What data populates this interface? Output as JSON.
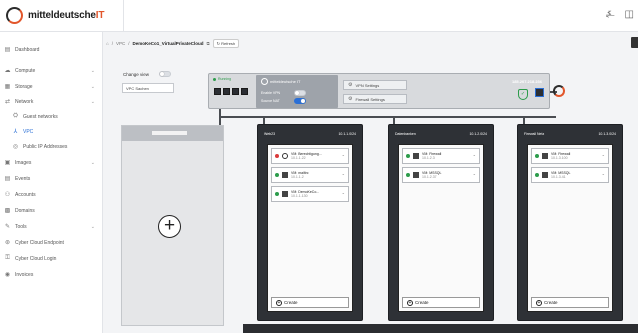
{
  "brand": {
    "name": "mitteldeutsche",
    "suffix": "IT"
  },
  "topbar_icons": [
    "bell-icon",
    "grid-icon"
  ],
  "sidebar": {
    "items": [
      {
        "label": "Dashboard",
        "icon": "dashboard-icon",
        "chevron": false
      },
      {
        "label": "Compute",
        "icon": "cloud-icon",
        "chevron": true
      },
      {
        "label": "Storage",
        "icon": "storage-icon",
        "chevron": true
      },
      {
        "label": "Network",
        "icon": "network-icon",
        "chevron": true
      },
      {
        "label": "Guest networks",
        "icon": "guest-network-icon",
        "chevron": false,
        "sub": true
      },
      {
        "label": "VPC",
        "icon": "vpc-icon",
        "chevron": false,
        "sub": true,
        "active": true
      },
      {
        "label": "Public IP Addresses",
        "icon": "ip-icon",
        "chevron": false,
        "sub": true
      },
      {
        "label": "Images",
        "icon": "image-icon",
        "chevron": true
      },
      {
        "label": "Events",
        "icon": "events-icon",
        "chevron": false
      },
      {
        "label": "Accounts",
        "icon": "accounts-icon",
        "chevron": false
      },
      {
        "label": "Domains",
        "icon": "domains-icon",
        "chevron": false
      },
      {
        "label": "Tools",
        "icon": "tools-icon",
        "chevron": true
      },
      {
        "label": "Cyber Cloud Endpoint",
        "icon": "endpoint-icon",
        "chevron": false
      },
      {
        "label": "Cyber Cloud Login",
        "icon": "login-icon",
        "chevron": false
      },
      {
        "label": "Invoices",
        "icon": "invoice-icon",
        "chevron": false
      }
    ]
  },
  "breadcrumb": {
    "home": "⌂",
    "sep": "/",
    "section": "VPC",
    "current": "DemoKeCo1_VirtualPrivateCloud",
    "refresh_label": "Refresh"
  },
  "view": {
    "change_view_label": "Change view",
    "vpc_name": "VPC Sachen"
  },
  "router": {
    "status": "Running",
    "brand": "mitteldeutsche IT",
    "toggle1_label": "Enable VPN",
    "toggle2_label": "Source NAT",
    "vpn_button": "VPN Settings",
    "firewall_button": "Firewall Settings",
    "ip": "185.207.218.236"
  },
  "racks": [
    {
      "name": "Web23",
      "ip": "10.1.1.0/24",
      "vms": [
        {
          "name": "VM: Berechtigung...",
          "ip": "10.1.1.22",
          "state": "stopped",
          "os": "linux"
        },
        {
          "name": "VM: mailtrc",
          "ip": "10.1.1.2",
          "state": "running",
          "os": "windows"
        },
        {
          "name": "VM: DemoKeCo...",
          "ip": "10.1.1.130",
          "state": "running",
          "os": "windows"
        }
      ],
      "create_label": "Create"
    },
    {
      "name": "Datenbanken",
      "ip": "10.1.2.0/24",
      "vms": [
        {
          "name": "VM: Firewall",
          "ip": "10.1.2.3",
          "state": "running",
          "os": "windows"
        },
        {
          "name": "VM: MSSQL",
          "ip": "10.1.2.37",
          "state": "running",
          "os": "windows"
        }
      ],
      "create_label": "Create"
    },
    {
      "name": "Firewall Netz",
      "ip": "10.1.3.0/24",
      "vms": [
        {
          "name": "VM: Firewall",
          "ip": "10.1.3.100",
          "state": "running",
          "os": "windows"
        },
        {
          "name": "VM: MSSQL",
          "ip": "10.1.3.41",
          "state": "running",
          "os": "windows"
        }
      ],
      "create_label": "Create"
    }
  ],
  "colors": {
    "accent": "#2a6fd6",
    "brand_orange": "#e2562b",
    "running": "#2c9c4b",
    "stopped": "#d93b3b",
    "rack": "#2e3136"
  }
}
